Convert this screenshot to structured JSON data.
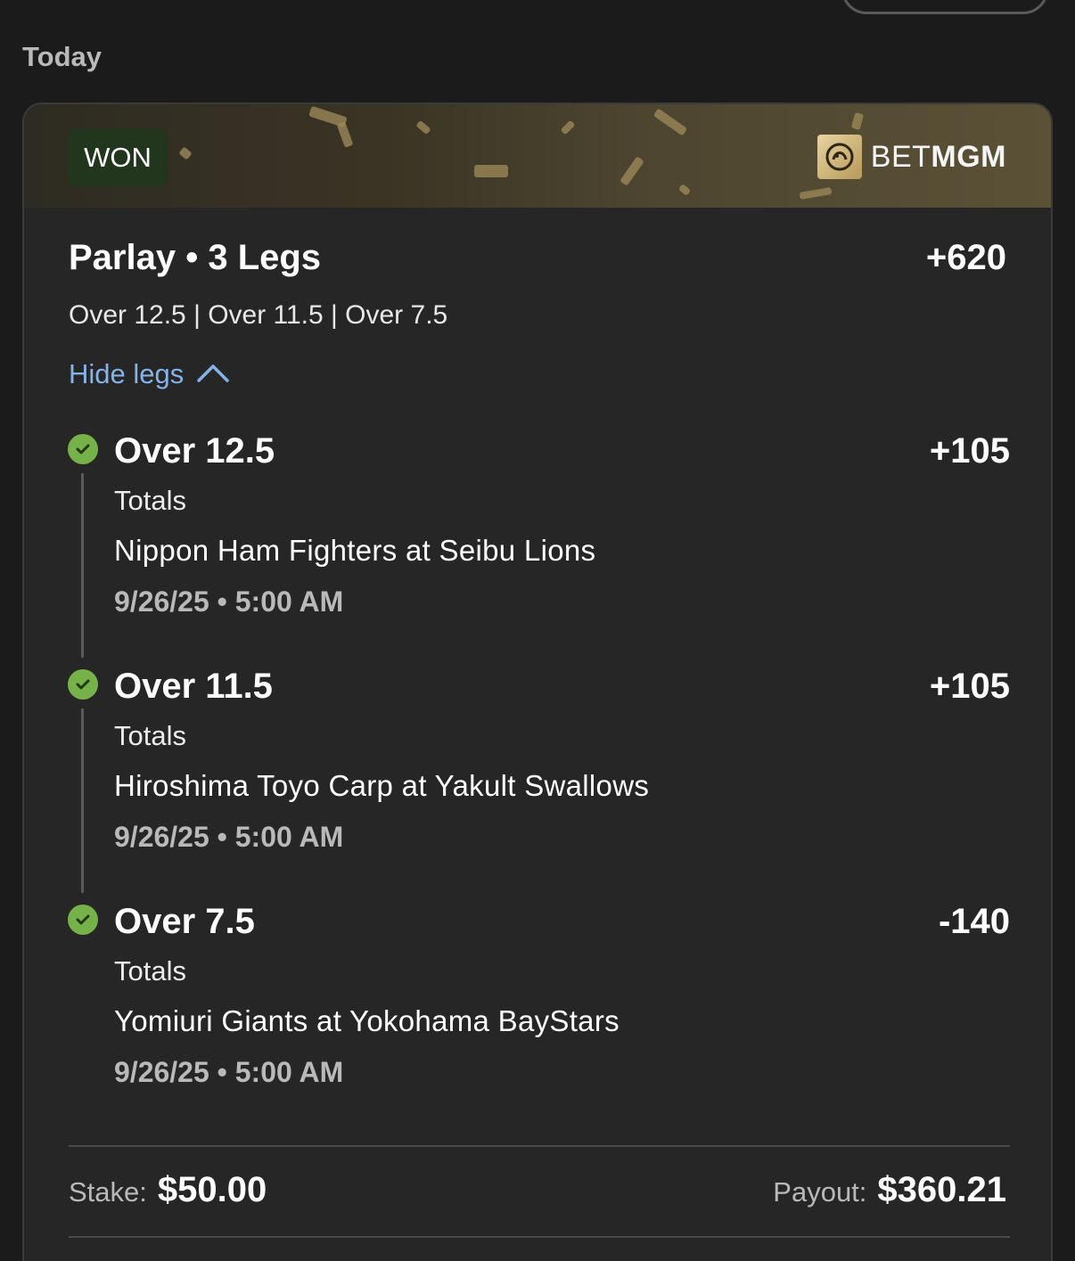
{
  "section": {
    "title": "Today"
  },
  "bet": {
    "status": "WON",
    "brand": {
      "prefix": "BET",
      "suffix": "MGM"
    },
    "title": "Parlay • 3 Legs",
    "odds": "+620",
    "summary": "Over 12.5 | Over 11.5 | Over 7.5",
    "toggle_label": "Hide legs",
    "legs": [
      {
        "name": "Over 12.5",
        "odds": "+105",
        "market": "Totals",
        "event": "Nippon Ham Fighters at Seibu Lions",
        "time": "9/26/25 • 5:00 AM"
      },
      {
        "name": "Over 11.5",
        "odds": "+105",
        "market": "Totals",
        "event": "Hiroshima Toyo Carp at Yakult Swallows",
        "time": "9/26/25 • 5:00 AM"
      },
      {
        "name": "Over 7.5",
        "odds": "-140",
        "market": "Totals",
        "event": "Yomiuri Giants at Yokohama BayStars",
        "time": "9/26/25 • 5:00 AM"
      }
    ],
    "stake": {
      "label": "Stake:",
      "value": "$50.00"
    },
    "payout": {
      "label": "Payout:",
      "value": "$360.21"
    }
  },
  "icons": {
    "check": "check-circle-icon",
    "chevron": "chevron-up-icon",
    "logo": "lion-logo-icon"
  },
  "colors": {
    "background": "#1b1b1b",
    "card": "#262626",
    "won_badge": "#21361d",
    "check_green": "#76b24a",
    "link_blue": "#84b2e9",
    "gold": "#9b8757"
  }
}
